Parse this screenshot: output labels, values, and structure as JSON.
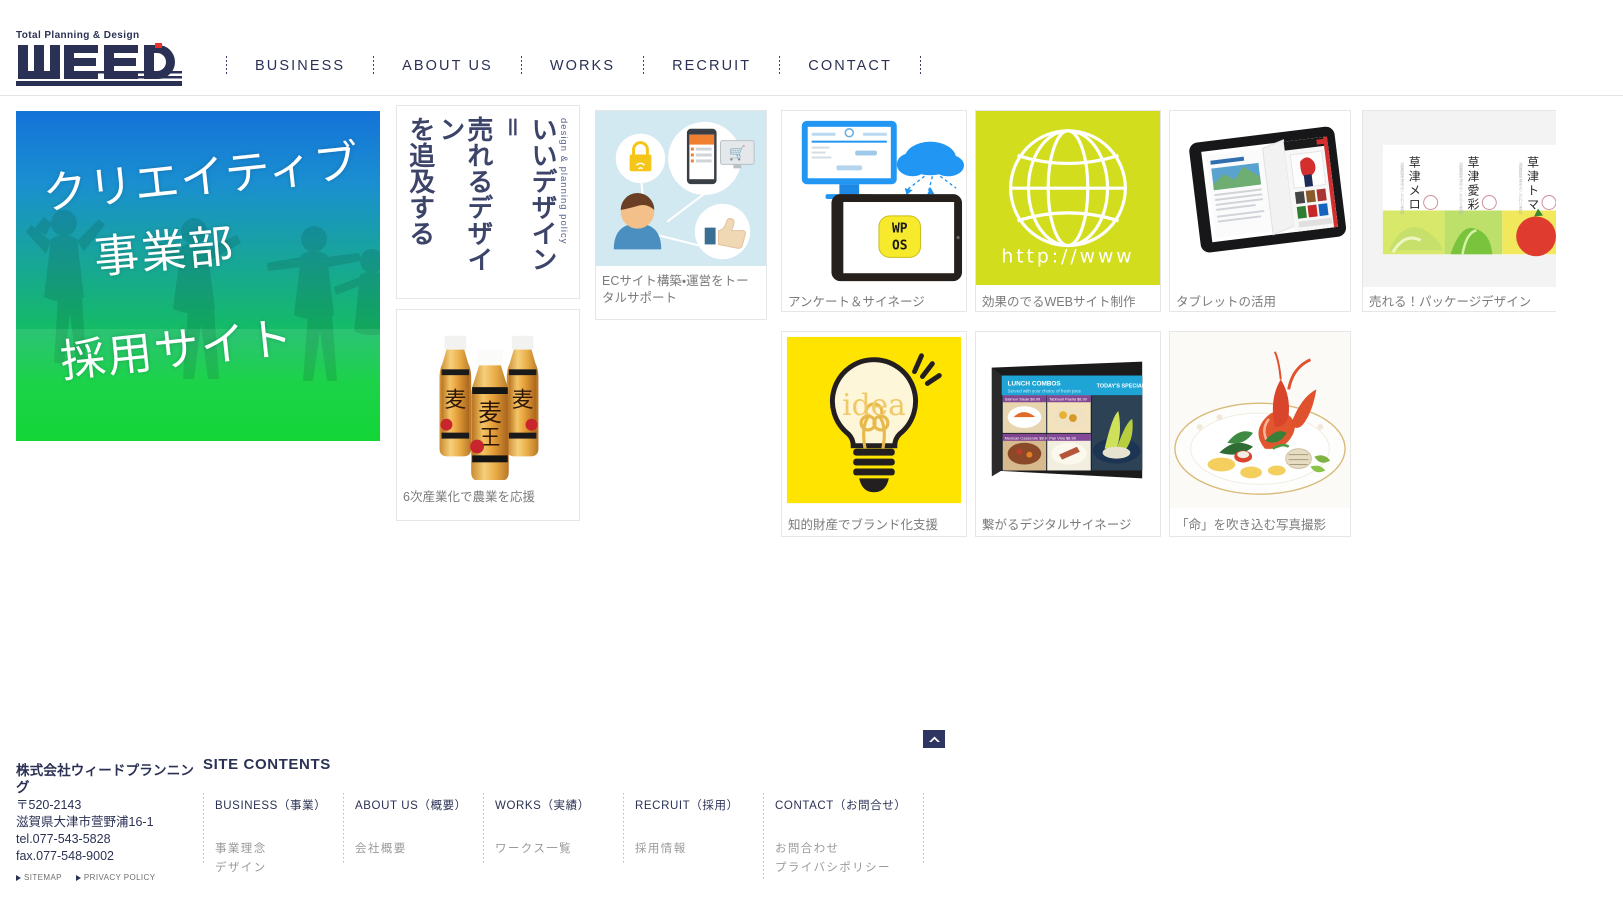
{
  "site": {
    "logo_tagline": "Total Planning & Design",
    "logo_text": "WEED"
  },
  "nav": {
    "items": [
      {
        "label": "BUSINESS"
      },
      {
        "label": "ABOUT US"
      },
      {
        "label": "WORKS"
      },
      {
        "label": "RECRUIT"
      },
      {
        "label": "CONTACT"
      }
    ]
  },
  "hero": {
    "line1": "クリエイティブ",
    "line2": "事業部",
    "line3": "採用サイト"
  },
  "policy": {
    "eyebrow": "design & planning policy",
    "line1": "いいデザイン",
    "equals": "＝",
    "line2": "売れるデザイン",
    "line3": "を追及する"
  },
  "cards": [
    {
      "id": "ec-site",
      "caption": "ECサイト構築・運営をトータルサポート"
    },
    {
      "id": "enquete",
      "caption": "アンケート＆サイネージ",
      "badge": "WPOS"
    },
    {
      "id": "web-site",
      "caption": "効果のでるWEBサイト制作",
      "badge": "http://www"
    },
    {
      "id": "tablet",
      "caption": "タブレットの活用"
    },
    {
      "id": "package",
      "caption": "売れる！パッケージデザイン",
      "labels": [
        "草津メロン飴",
        "草津愛彩菜飴",
        "草津トマト飴"
      ]
    },
    {
      "id": "agri",
      "caption": "6次産業化で農業を応援",
      "badge": "麦王"
    },
    {
      "id": "idea",
      "caption": "知的財産でブランド化支援",
      "badge": "idea"
    },
    {
      "id": "signage",
      "caption": "繋がるデジタルサイネージ",
      "screen": {
        "title": "LUNCH COMBOS",
        "subtitle": "Served with your choice of fresh juice",
        "special": "TODAY'S SPECIAL",
        "items": [
          "Salmon Steak $8.99",
          "Tabbouli Paella $8.99",
          "Mexican Casserole $8.99",
          "Pan Viva $8.99"
        ]
      }
    },
    {
      "id": "photo",
      "caption": "「命」を吹き込む写真撮影"
    }
  ],
  "totop": {
    "label": "page top"
  },
  "footer": {
    "company_name": "株式会社ウィードプランニング",
    "postal": "〒520-2143",
    "address": "滋賀県大津市萱野浦16-1",
    "tel": "tel.077-543-5828",
    "fax": "fax.077-548-9002",
    "links": [
      {
        "label": "SITEMAP"
      },
      {
        "label": "PRIVACY POLICY"
      }
    ],
    "contents_title": "SITE CONTENTS",
    "columns": [
      {
        "head": "BUSINESS（事業）",
        "subs": [
          "事業理念",
          "デザイン"
        ]
      },
      {
        "head": "ABOUT US（概要）",
        "subs": [
          "会社概要"
        ]
      },
      {
        "head": "WORKS（実績）",
        "subs": [
          "ワークス一覧"
        ]
      },
      {
        "head": "RECRUIT（採用）",
        "subs": [
          "採用情報"
        ]
      },
      {
        "head": "CONTACT（お問合せ）",
        "subs": [
          "お問合わせ",
          "プライバシポリシー"
        ]
      }
    ]
  },
  "colors": {
    "navy": "#2b3154",
    "caption_gray": "#7b7b7b",
    "card_border": "#e6e6e6",
    "accent_yellow": "#ffe400",
    "accent_lime": "#d2dd1e",
    "logo_red": "#e8332a"
  }
}
